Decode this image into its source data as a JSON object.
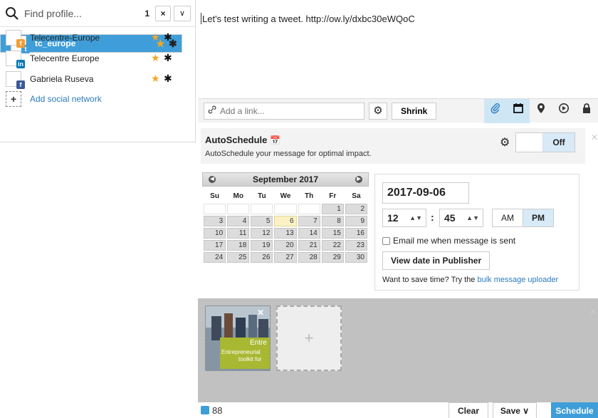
{
  "profile_panel": {
    "search_placeholder": "Find profile...",
    "selected_count": "1",
    "clear_label": "×",
    "dropdown_label": "∨",
    "profiles": [
      {
        "name": "tc_europe",
        "network": "twitter",
        "selected": true
      },
      {
        "name": "Telecentre-Europe",
        "network": "facebook",
        "selected": false
      },
      {
        "name": "Telecentre Europe",
        "network": "linkedin",
        "selected": false
      },
      {
        "name": "Gabriela Ruseva",
        "network": "facebook",
        "selected": false
      }
    ],
    "add_network_label": "Add social network",
    "add_network_icon": "+"
  },
  "composer": {
    "message": "Let's test writing a tweet.  http://ow.ly/dxbc30eWQoC",
    "link_placeholder": "Add a link...",
    "shrink_label": "Shrink"
  },
  "autoschedule": {
    "title": "AutoSchedule",
    "description": "AutoSchedule your message for optimal impact.",
    "toggle_state": "Off"
  },
  "calendar": {
    "month_label": "September 2017",
    "weekdays": [
      "Su",
      "Mo",
      "Tu",
      "We",
      "Th",
      "Fr",
      "Sa"
    ],
    "weeks": [
      [
        "",
        "",
        "",
        "",
        "",
        "1",
        "2"
      ],
      [
        "3",
        "4",
        "5",
        "6",
        "7",
        "8",
        "9"
      ],
      [
        "10",
        "11",
        "12",
        "13",
        "14",
        "15",
        "16"
      ],
      [
        "17",
        "18",
        "19",
        "20",
        "21",
        "22",
        "23"
      ],
      [
        "24",
        "25",
        "26",
        "27",
        "28",
        "29",
        "30"
      ]
    ],
    "selected_day": "6"
  },
  "schedule": {
    "date": "2017-09-06",
    "hour": "12",
    "minute": "45",
    "am_label": "AM",
    "pm_label": "PM",
    "email_label": "Email me when message is sent",
    "view_button": "View date in Publisher",
    "save_time_text": "Want to save time? Try the ",
    "bulk_link": "bulk message uploader"
  },
  "media": {
    "thumb_caption_title": "Entre",
    "thumb_caption_lines": [
      "Entrepreneurial",
      "toolkit for"
    ],
    "add_label": "+"
  },
  "footer": {
    "char_count": "88",
    "clear_label": "Clear",
    "save_label": "Save ∨",
    "schedule_label": "Schedule"
  },
  "colors": {
    "accent": "#3f9ed9",
    "link": "#2a7bc0",
    "star": "#f5a623",
    "today": "#fbf1c7"
  }
}
